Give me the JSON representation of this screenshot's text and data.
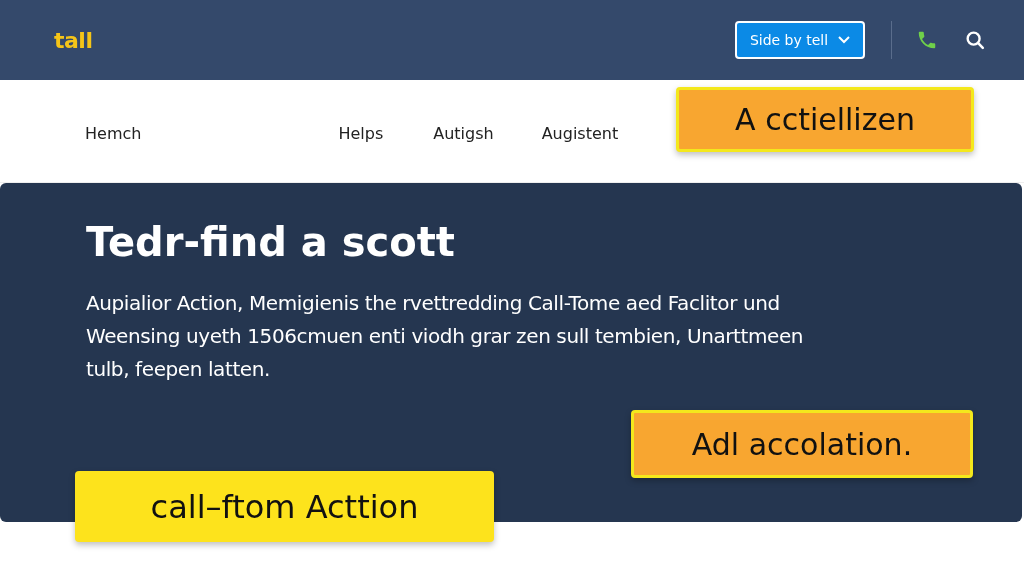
{
  "header": {
    "logo": "tall",
    "view_select": {
      "label": "Side by tell"
    }
  },
  "nav": {
    "items": [
      {
        "label": "Hemch"
      },
      {
        "label": "Helps"
      },
      {
        "label": "Autigsh"
      },
      {
        "label": "Augistent"
      }
    ],
    "cta": "A cctiellizen"
  },
  "hero": {
    "title": "Tedr-find a scott",
    "text": "Aupialior Action, Memigienis the rvettredding Call-Tome aed Faclitor und Weensing uyeth 1506cmuen enti viodh grar zen sull tembien, Unarttmeen tulb, feepen latten.",
    "secondary_button": "Adl accolation.",
    "primary_button": "call–ftom Acttion"
  }
}
